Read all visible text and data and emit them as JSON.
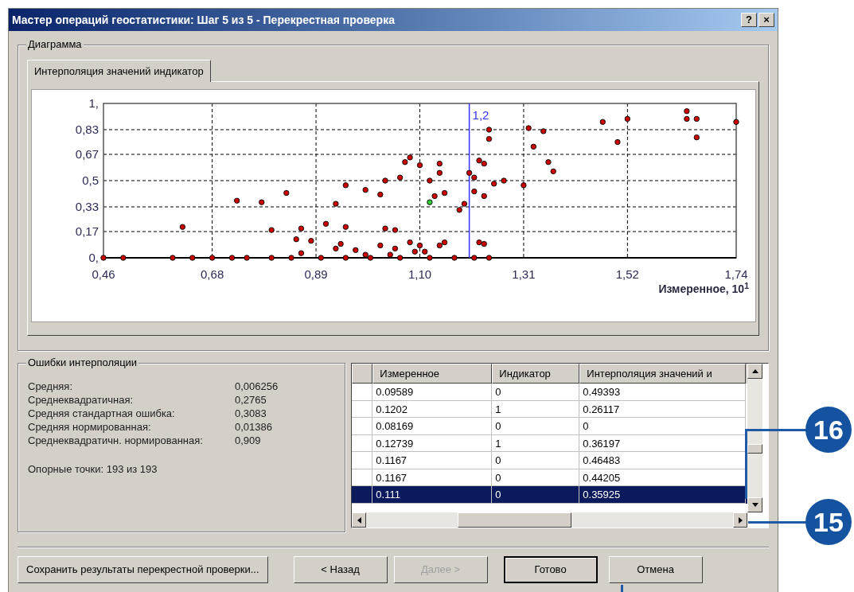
{
  "window": {
    "title": "Мастер операций геостатистики: Шаг 5 из 5 - Перекрестная проверка",
    "title_buttons": [
      "?",
      "×"
    ]
  },
  "diagram": {
    "legend": "Диаграмма",
    "tabs": [
      {
        "label": "Интерполяция значений индикатор",
        "selected": true
      }
    ],
    "chart_data": {
      "type": "scatter",
      "xlabel": "Измеренное, 10$^{1}$",
      "xlim": [
        0.46,
        1.74
      ],
      "ylim": [
        0,
        1
      ],
      "xticks": [
        {
          "value": 0.46,
          "label": "0,46"
        },
        {
          "value": 0.68,
          "label": "0,68"
        },
        {
          "value": 0.89,
          "label": "0,89"
        },
        {
          "value": 1.1,
          "label": "1,10"
        },
        {
          "value": 1.31,
          "label": "1,31"
        },
        {
          "value": 1.52,
          "label": "1,52"
        },
        {
          "value": 1.74,
          "label": "1,74"
        }
      ],
      "yticks": [
        {
          "value": 0,
          "label": "0,"
        },
        {
          "value": 0.17,
          "label": "0,17"
        },
        {
          "value": 0.33,
          "label": "0,33"
        },
        {
          "value": 0.5,
          "label": "0,5"
        },
        {
          "value": 0.67,
          "label": "0,67"
        },
        {
          "value": 0.83,
          "label": "0,83"
        },
        {
          "value": 1,
          "label": "1,"
        }
      ],
      "x": [
        1.64,
        1.64,
        1.66,
        1.66,
        1.74,
        1.52,
        1.47,
        1.5,
        1.32,
        1.35,
        1.33,
        1.36,
        1.37,
        1.24,
        1.24,
        1.22,
        1.23,
        1.2,
        1.21,
        1.25,
        1.27,
        1.31,
        1.23,
        1.21,
        1.19,
        1.18,
        1.14,
        1.14,
        1.15,
        1.13,
        1.12,
        1.1,
        1.08,
        1.07,
        1.06,
        1.03,
        1.02,
        0.99,
        0.95,
        0.93,
        0.83,
        0.78,
        0.73,
        0.62,
        0.91,
        0.95,
        0.86,
        0.85,
        0.8,
        0.88,
        1.03,
        1.05,
        1.08,
        1.1,
        1.05,
        1.02,
        1.14,
        1.15,
        1.22,
        1.23,
        1.21,
        1.24,
        1.11,
        1.09,
        0.97,
        0.94,
        0.93,
        0.86,
        0.99,
        1.04,
        0.46,
        0.5,
        0.6,
        0.64,
        0.68,
        0.72,
        0.75,
        0.8,
        0.84,
        0.9,
        0.95,
        1.0,
        1.06,
        1.12,
        1.17,
        1.12
      ],
      "series": [
        {
          "color": "#cc0000",
          "values": [
            0.95,
            0.9,
            0.9,
            0.78,
            0.88,
            0.9,
            0.88,
            0.75,
            0.84,
            0.82,
            0.72,
            0.62,
            0.56,
            0.83,
            0.77,
            0.63,
            0.61,
            0.55,
            0.52,
            0.48,
            0.5,
            0.47,
            0.4,
            0.43,
            0.35,
            0.31,
            0.61,
            0.55,
            0.42,
            0.4,
            0.5,
            0.6,
            0.65,
            0.62,
            0.52,
            0.5,
            0.41,
            0.44,
            0.47,
            0.35,
            0.42,
            0.36,
            0.37,
            0.2,
            0.22,
            0.2,
            0.19,
            0.12,
            0.18,
            0.11,
            0.19,
            0.18,
            0.1,
            0.08,
            0.06,
            0.08,
            0.08,
            0.1,
            0.1,
            0.09,
            0.0,
            0.0,
            0.04,
            0.04,
            0.05,
            0.09,
            0.06,
            0.03,
            0.02,
            0.02,
            0,
            0,
            0,
            0,
            0,
            0,
            0,
            0,
            0,
            0,
            0,
            0,
            0,
            0,
            0,
            null
          ]
        },
        {
          "color": "#33cc33",
          "values": [
            null,
            null,
            null,
            null,
            null,
            null,
            null,
            null,
            null,
            null,
            null,
            null,
            null,
            null,
            null,
            null,
            null,
            null,
            null,
            null,
            null,
            null,
            null,
            null,
            null,
            null,
            null,
            null,
            null,
            null,
            null,
            null,
            null,
            null,
            null,
            null,
            null,
            null,
            null,
            null,
            null,
            null,
            null,
            null,
            null,
            null,
            null,
            null,
            null,
            null,
            null,
            null,
            null,
            null,
            null,
            null,
            null,
            null,
            null,
            null,
            null,
            null,
            null,
            null,
            null,
            null,
            null,
            null,
            null,
            null,
            null,
            null,
            null,
            null,
            null,
            null,
            null,
            null,
            null,
            null,
            null,
            null,
            null,
            null,
            null,
            0.36
          ]
        }
      ],
      "grid": true,
      "ref_lines": [
        {
          "axis": "x",
          "value": 1.2,
          "label": "1,2",
          "color": "#3333ff"
        }
      ]
    }
  },
  "errors": {
    "legend": "Ошибки интерполяции",
    "stats": [
      {
        "label": "Средняя:",
        "value": "0,006256"
      },
      {
        "label": "Среднеквадратичная:",
        "value": "0,2765"
      },
      {
        "label": "Средняя стандартная ошибка:",
        "value": "0,3083"
      },
      {
        "label": "Средняя нормированная:",
        "value": "0,01386"
      },
      {
        "label": "Среднеквадратичн. нормированная:",
        "value": "0,909"
      }
    ],
    "support_points": "Опорные точки: 193 из 193"
  },
  "table": {
    "columns": [
      "Измеренное",
      "Индикатор",
      "Интерполяция значений и"
    ],
    "rows": [
      {
        "cells": [
          "0.09589",
          "0",
          "0.49393"
        ],
        "selected": false
      },
      {
        "cells": [
          "0.1202",
          "1",
          "0.26117"
        ],
        "selected": false
      },
      {
        "cells": [
          "0.08169",
          "0",
          "0"
        ],
        "selected": false
      },
      {
        "cells": [
          "0.12739",
          "1",
          "0.36197"
        ],
        "selected": false
      },
      {
        "cells": [
          "0.1167",
          "0",
          "0.46483"
        ],
        "selected": false
      },
      {
        "cells": [
          "0.1167",
          "0",
          "0.44205"
        ],
        "selected": false
      },
      {
        "cells": [
          "0.111",
          "0",
          "0.35925"
        ],
        "selected": true
      }
    ]
  },
  "buttons": [
    {
      "label": "Сохранить результаты перекрестной проверки...",
      "disabled": false,
      "default": false
    },
    {
      "label": "< Назад",
      "disabled": false,
      "default": false
    },
    {
      "label": "Далее >",
      "disabled": true,
      "default": false
    },
    {
      "label": "Готово",
      "disabled": false,
      "default": true
    },
    {
      "label": "Отмена",
      "disabled": false,
      "default": false
    }
  ],
  "callouts": [
    {
      "label": "16"
    },
    {
      "label": "15"
    }
  ]
}
